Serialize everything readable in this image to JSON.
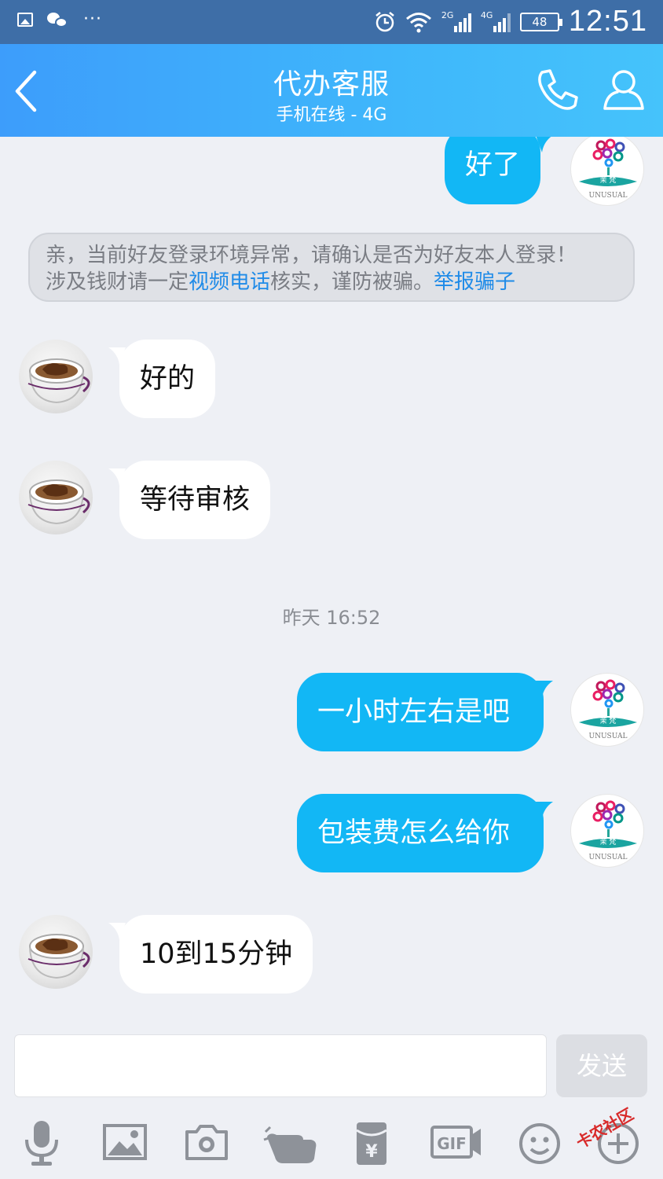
{
  "status_bar": {
    "left_icons": [
      "picture-icon",
      "wechat-icon",
      "more-dots-icon"
    ],
    "dots": "···",
    "network_2g": "2G",
    "network_4g": "4G",
    "battery": "48",
    "time": "12:51"
  },
  "header": {
    "title": "代办客服",
    "subtitle": "手机在线 - 4G",
    "back_icon": "chevron-left-icon",
    "call_icon": "phone-icon",
    "profile_icon": "user-icon",
    "color": "#3fb7fb"
  },
  "messages": [
    {
      "side": "out",
      "text": "好了"
    },
    {
      "side": "in",
      "text": "好的"
    },
    {
      "side": "in",
      "text": "等待审核"
    },
    {
      "side": "out",
      "text": "一小时左右是吧"
    },
    {
      "side": "out",
      "text": "包装费怎么给你"
    },
    {
      "side": "in",
      "text": "10到15分钟"
    }
  ],
  "notice": {
    "line1": "亲，当前好友登录环境异常，请确认是否为好友本人登录！",
    "line2_a": "涉及钱财请一定",
    "line2_link1": "视频电话",
    "line2_b": "核实，谨防被骗。",
    "line2_link2": "举报骗子"
  },
  "timestamp": "昨天 16:52",
  "avatar_mine_text": {
    "brand": "茉 梵",
    "caption": "UNUSUAL"
  },
  "input": {
    "placeholder": "",
    "send_label": "发送"
  },
  "toolbar": [
    "microphone-icon",
    "image-icon",
    "camera-icon",
    "hand-poke-icon",
    "red-packet-icon",
    "gif-icon",
    "emoji-icon",
    "plus-icon"
  ],
  "red_packet_symbol": "¥",
  "gif_label": "GIF",
  "watermark": "卡农社区",
  "colors": {
    "outgoing": "#12b7f5",
    "incoming": "#ffffff",
    "background": "#eef0f5",
    "link": "#1f8be8"
  }
}
